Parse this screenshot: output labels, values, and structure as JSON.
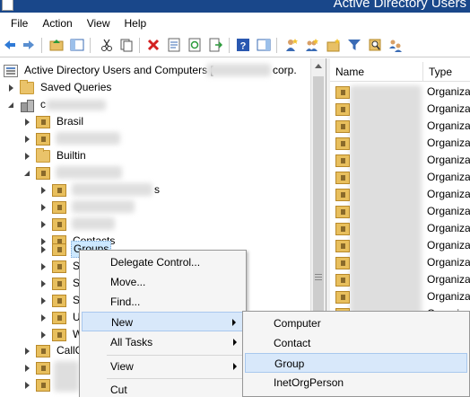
{
  "window": {
    "title": "Active Directory Users"
  },
  "menu": [
    "File",
    "Action",
    "View",
    "Help"
  ],
  "toolbar": {
    "buttons": [
      "back-arrow-icon",
      "forward-arrow-icon",
      "up-folder-icon",
      "show-hide-tree-icon",
      "cut-icon",
      "copy-icon",
      "delete-icon",
      "properties-icon",
      "refresh-icon",
      "export-list-icon",
      "help-icon",
      "action-pane-icon",
      "new-user-icon",
      "new-group-icon",
      "new-ou-icon",
      "filter-icon",
      "find-icon",
      "add-to-group-icon"
    ]
  },
  "tree": {
    "root_label": "Active Directory Users and Computers [",
    "root_suffix": "corp.",
    "saved_queries": "Saved Queries",
    "domain_prefix": "c",
    "brasil": "Brasil",
    "builtin": "Builtin",
    "child_s_suffix": "s",
    "contacts": "Contacts",
    "groups": "Groups",
    "s1": "S",
    "s2": "S",
    "s3": "S",
    "u": "U",
    "w": "W",
    "callc": "CallC"
  },
  "list": {
    "columns": [
      "Name",
      "Type"
    ],
    "type_value": "Organizat"
  },
  "context_menu": {
    "items": [
      "Delegate Control...",
      "Move...",
      "Find...",
      "New",
      "All Tasks",
      "View",
      "Cut"
    ]
  },
  "submenu": {
    "items": [
      "Computer",
      "Contact",
      "Group",
      "InetOrgPerson"
    ]
  },
  "colors": {
    "title_bar": "#19478a",
    "highlight": "#d8e8fa"
  }
}
